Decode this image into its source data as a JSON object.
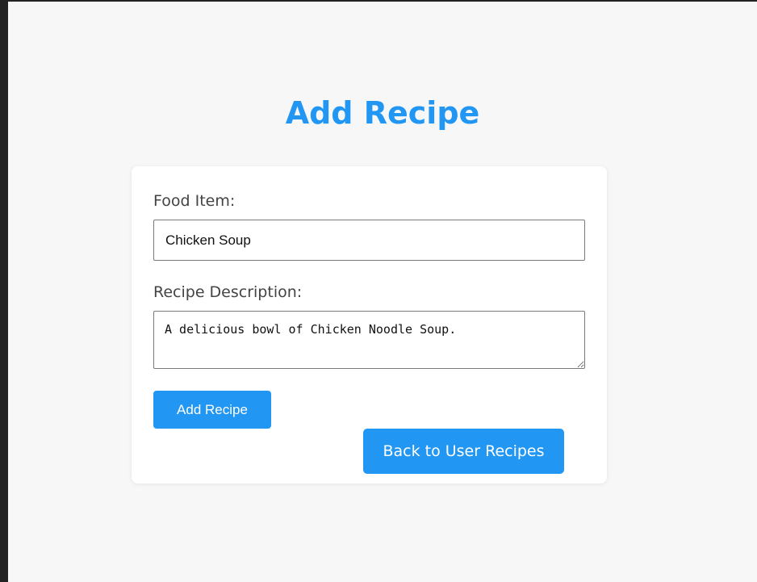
{
  "page": {
    "title": "Add Recipe"
  },
  "form": {
    "food_label": "Food Item:",
    "food_value": "Chicken Soup",
    "description_label": "Recipe Description:",
    "description_value": "A delicious bowl of Chicken Noodle Soup.",
    "submit_label": "Add Recipe",
    "back_label": "Back to User Recipes"
  },
  "colors": {
    "accent": "#2196f3",
    "background": "#f7f7f7",
    "card": "#ffffff",
    "label_text": "#444444"
  }
}
